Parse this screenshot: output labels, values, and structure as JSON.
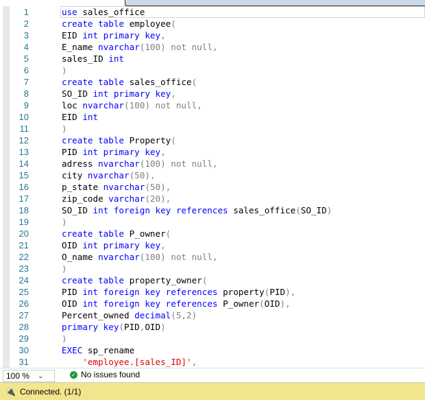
{
  "editor": {
    "lines": [
      [
        [
          "use ",
          "k"
        ],
        [
          "sales_office",
          "t"
        ]
      ],
      [
        [
          "create table ",
          "k"
        ],
        [
          "employee",
          "t"
        ],
        [
          "(",
          "g"
        ]
      ],
      [
        [
          "EID ",
          "t"
        ],
        [
          "int primary key",
          "k"
        ],
        [
          ",",
          "g"
        ]
      ],
      [
        [
          "E_name ",
          "t"
        ],
        [
          "nvarchar",
          "k"
        ],
        [
          "(100) not null,",
          "g"
        ]
      ],
      [
        [
          "sales_ID ",
          "t"
        ],
        [
          "int",
          "k"
        ]
      ],
      [
        [
          ")",
          "g"
        ]
      ],
      [
        [
          "create table ",
          "k"
        ],
        [
          "sales_office",
          "t"
        ],
        [
          "(",
          "g"
        ]
      ],
      [
        [
          "SO_ID ",
          "t"
        ],
        [
          "int primary key",
          "k"
        ],
        [
          ",",
          "g"
        ]
      ],
      [
        [
          "loc ",
          "t"
        ],
        [
          "nvarchar",
          "k"
        ],
        [
          "(100) not null,",
          "g"
        ]
      ],
      [
        [
          "EID ",
          "t"
        ],
        [
          "int",
          "k"
        ]
      ],
      [
        [
          ")",
          "g"
        ]
      ],
      [
        [
          "create table ",
          "k"
        ],
        [
          "Property",
          "t"
        ],
        [
          "(",
          "g"
        ]
      ],
      [
        [
          "PID ",
          "t"
        ],
        [
          "int primary key",
          "k"
        ],
        [
          ",",
          "g"
        ]
      ],
      [
        [
          "adress ",
          "t"
        ],
        [
          "nvarchar",
          "k"
        ],
        [
          "(100) not null,",
          "g"
        ]
      ],
      [
        [
          "city ",
          "t"
        ],
        [
          "nvarchar",
          "k"
        ],
        [
          "(50),",
          "g"
        ]
      ],
      [
        [
          "p_state ",
          "t"
        ],
        [
          "nvarchar",
          "k"
        ],
        [
          "(50),",
          "g"
        ]
      ],
      [
        [
          "zip_code ",
          "t"
        ],
        [
          "varchar",
          "k"
        ],
        [
          "(20),",
          "g"
        ]
      ],
      [
        [
          "SO_ID ",
          "t"
        ],
        [
          "int foreign key references ",
          "k"
        ],
        [
          "sales_office",
          "t"
        ],
        [
          "(",
          "g"
        ],
        [
          "SO_ID",
          "t"
        ],
        [
          ")",
          "g"
        ]
      ],
      [
        [
          ")",
          "g"
        ]
      ],
      [
        [
          "create table ",
          "k"
        ],
        [
          "P_owner",
          "t"
        ],
        [
          "(",
          "g"
        ]
      ],
      [
        [
          "OID ",
          "t"
        ],
        [
          "int primary key",
          "k"
        ],
        [
          ",",
          "g"
        ]
      ],
      [
        [
          "O_name ",
          "t"
        ],
        [
          "nvarchar",
          "k"
        ],
        [
          "(100) not null,",
          "g"
        ]
      ],
      [
        [
          ")",
          "g"
        ]
      ],
      [
        [
          "create table ",
          "k"
        ],
        [
          "property_owner",
          "t"
        ],
        [
          "(",
          "g"
        ]
      ],
      [
        [
          "PID ",
          "t"
        ],
        [
          "int foreign key references ",
          "k"
        ],
        [
          "property",
          "t"
        ],
        [
          "(",
          "g"
        ],
        [
          "PID",
          "t"
        ],
        [
          "),",
          "g"
        ]
      ],
      [
        [
          "OID ",
          "t"
        ],
        [
          "int foreign key references ",
          "k"
        ],
        [
          "P_owner",
          "t"
        ],
        [
          "(",
          "g"
        ],
        [
          "OID",
          "t"
        ],
        [
          "),",
          "g"
        ]
      ],
      [
        [
          "Percent_owned ",
          "t"
        ],
        [
          "decimal",
          "k"
        ],
        [
          "(5,2)",
          "g"
        ]
      ],
      [
        [
          "primary key",
          "k"
        ],
        [
          "(",
          "g"
        ],
        [
          "PID",
          "t"
        ],
        [
          ",",
          "g"
        ],
        [
          "OID",
          "t"
        ],
        [
          ")",
          "g"
        ]
      ],
      [
        [
          ")",
          "g"
        ]
      ],
      [
        [
          "EXEC ",
          "k"
        ],
        [
          "sp_rename",
          "t"
        ]
      ],
      [
        [
          "    ",
          "t"
        ],
        [
          "'employee.[sales_ID]'",
          "s"
        ],
        [
          ",",
          "g"
        ]
      ]
    ]
  },
  "status": {
    "zoom": "100 %",
    "issues": "No issues found"
  },
  "connection": {
    "text": "Connected. (1/1)"
  }
}
